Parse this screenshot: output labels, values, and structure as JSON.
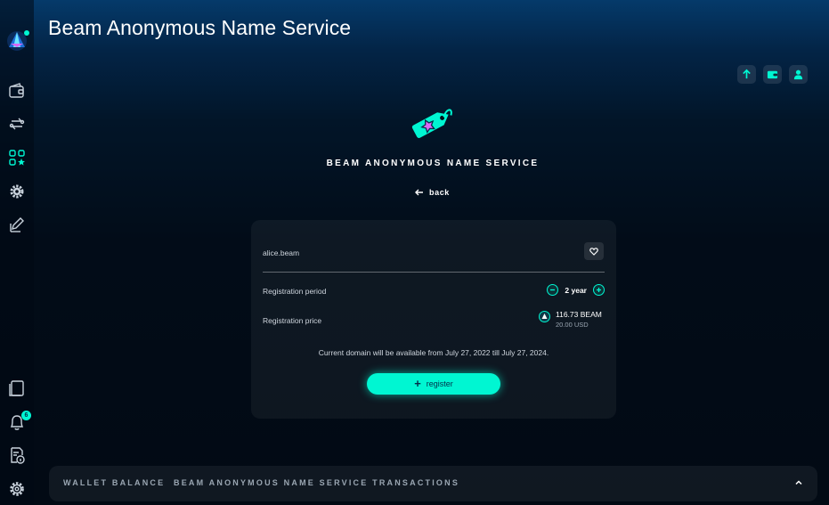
{
  "app": {
    "title": "Beam Anonymous Name Service"
  },
  "sidebar": {
    "items": [
      {
        "name": "wallet",
        "icon": "wallet-icon"
      },
      {
        "name": "transactions",
        "icon": "transactions-icon"
      },
      {
        "name": "dapps",
        "icon": "dapps-icon",
        "active": true
      },
      {
        "name": "settings-gear",
        "icon": "gear-icon"
      },
      {
        "name": "notes",
        "icon": "pen-icon"
      }
    ],
    "bottom_items": [
      {
        "name": "documentation",
        "icon": "document-icon"
      },
      {
        "name": "notifications",
        "icon": "bell-icon",
        "badge": "6"
      },
      {
        "name": "info",
        "icon": "info-icon"
      },
      {
        "name": "settings",
        "icon": "settings-icon"
      }
    ]
  },
  "header": {
    "actions": [
      {
        "name": "send",
        "icon": "arrow-up-icon"
      },
      {
        "name": "wallet",
        "icon": "wallet-icon"
      },
      {
        "name": "profile",
        "icon": "user-icon"
      }
    ]
  },
  "hero": {
    "title": "BEAM ANONYMOUS NAME SERVICE",
    "back_label": "back"
  },
  "card": {
    "domain": "alice.beam",
    "period_label": "Registration period",
    "period_value": "2 year",
    "price_label": "Registration price",
    "price_beam": "116.73 BEAM",
    "price_usd": "20.00 USD",
    "note": "Current domain will be available from July 27, 2022 till July 27, 2024.",
    "register_label": "register"
  },
  "bottom": {
    "tab_balance": "WALLET BALANCE",
    "tab_transactions": "BEAM ANONYMOUS NAME SERVICE TRANSACTIONS"
  },
  "colors": {
    "accent": "#00f6d2",
    "pink": "#da68f5",
    "background": "#020c18",
    "dark_text": "#032e49"
  }
}
